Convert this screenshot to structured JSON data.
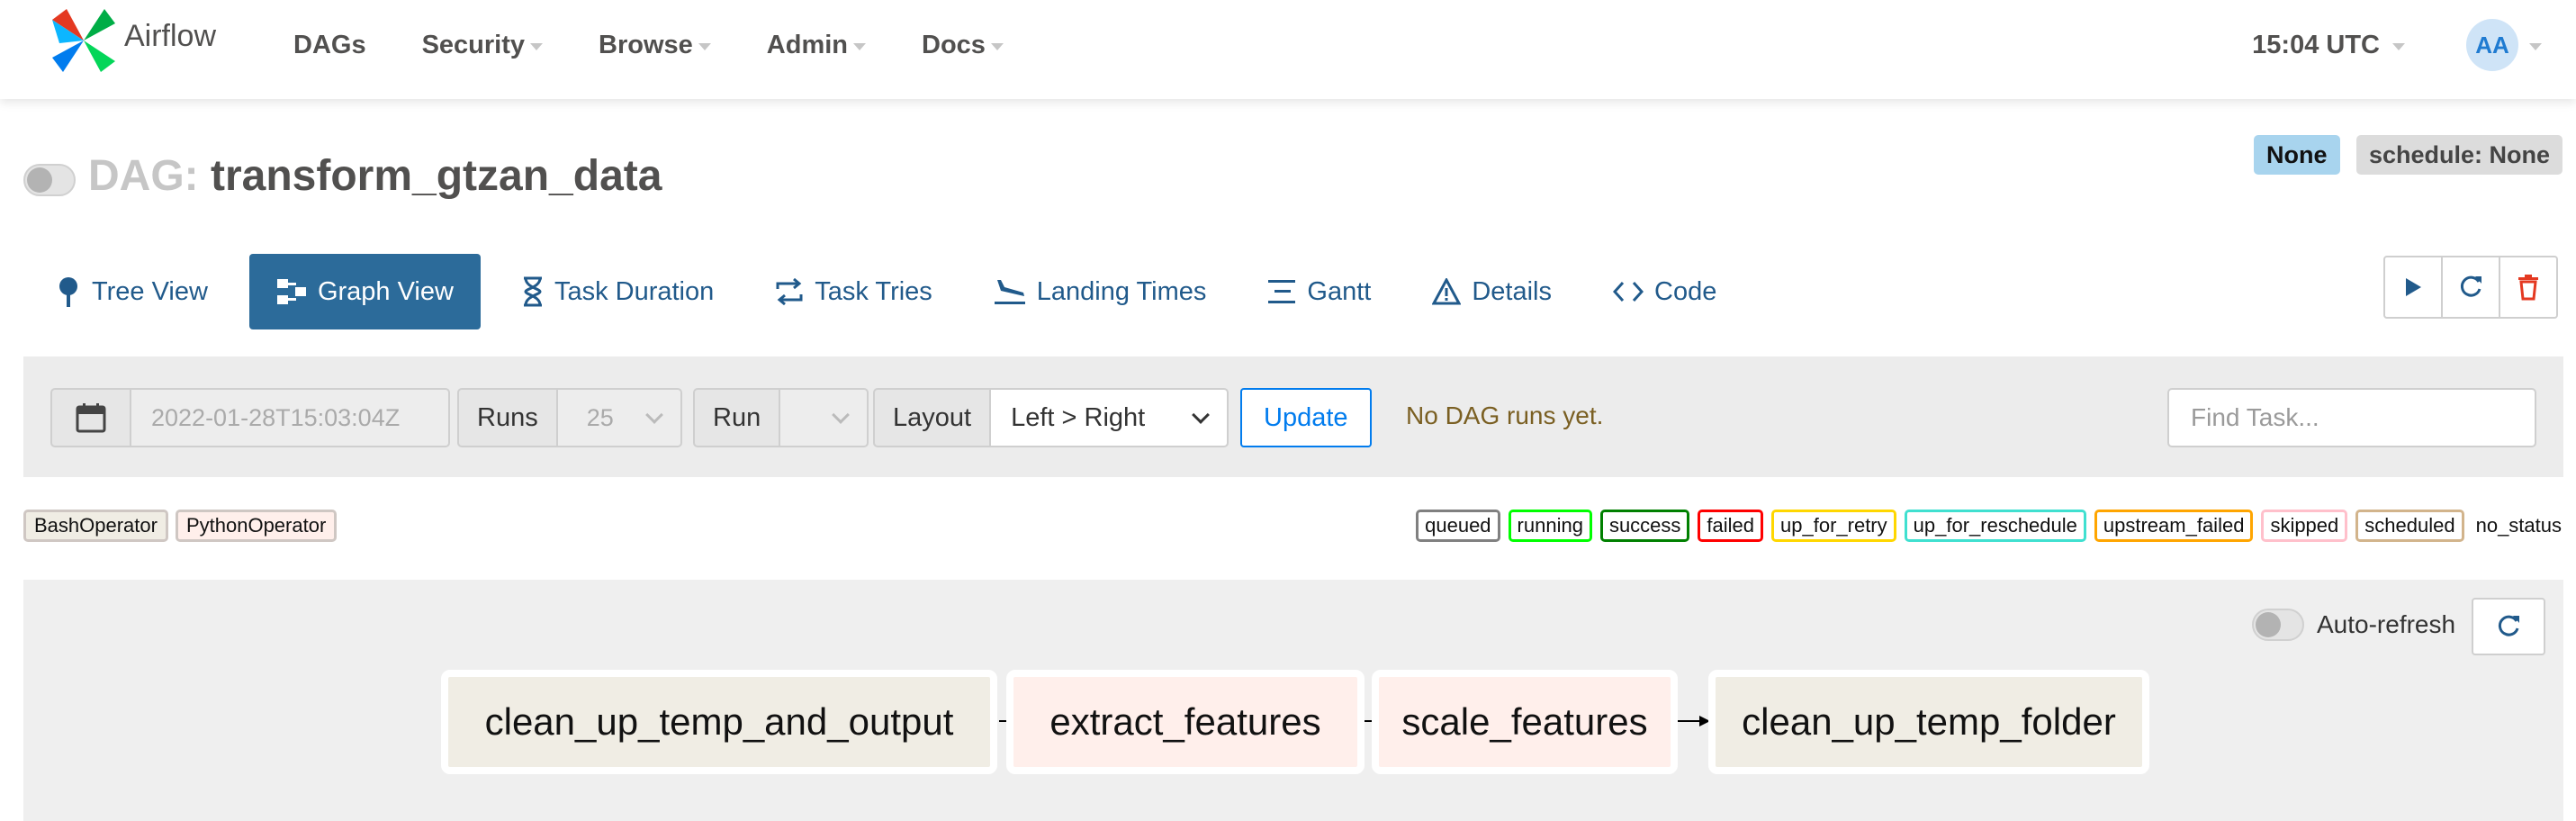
{
  "brand": {
    "name": "Airflow"
  },
  "nav": {
    "items": [
      "DAGs",
      "Security",
      "Browse",
      "Admin",
      "Docs"
    ],
    "clock": "15:04 UTC",
    "user_initials": "AA"
  },
  "dag": {
    "prefix": "DAG:",
    "id": "transform_gtzan_data",
    "label_none": "None",
    "schedule": "schedule: None"
  },
  "tabs": [
    {
      "label": "Tree View",
      "icon": "tree-icon",
      "active": false
    },
    {
      "label": "Graph View",
      "icon": "graph-icon",
      "active": true
    },
    {
      "label": "Task Duration",
      "icon": "hourglass-icon",
      "active": false
    },
    {
      "label": "Task Tries",
      "icon": "retry-icon",
      "active": false
    },
    {
      "label": "Landing Times",
      "icon": "plane-landing-icon",
      "active": false
    },
    {
      "label": "Gantt",
      "icon": "gantt-icon",
      "active": false
    },
    {
      "label": "Details",
      "icon": "warning-triangle-icon",
      "active": false
    },
    {
      "label": "Code",
      "icon": "code-icon",
      "active": false
    }
  ],
  "filters": {
    "base_date": "2022-01-28T15:03:04Z",
    "runs_label": "Runs",
    "runs_value": "25",
    "run_label": "Run",
    "run_value": "",
    "layout_label": "Layout",
    "layout_value": "Left > Right",
    "update_label": "Update",
    "status_message": "No DAG runs yet.",
    "find_placeholder": "Find Task..."
  },
  "operators": [
    {
      "label": "BashOperator",
      "color": "#f0ede4"
    },
    {
      "label": "PythonOperator",
      "color": "#ffefeb"
    }
  ],
  "states": [
    {
      "label": "queued",
      "color": "#808080"
    },
    {
      "label": "running",
      "color": "#00ff00"
    },
    {
      "label": "success",
      "color": "#008000"
    },
    {
      "label": "failed",
      "color": "#ff0000"
    },
    {
      "label": "up_for_retry",
      "color": "#ffd700"
    },
    {
      "label": "up_for_reschedule",
      "color": "#40e0d0"
    },
    {
      "label": "upstream_failed",
      "color": "#ffa500"
    },
    {
      "label": "skipped",
      "color": "#ffc0cb"
    },
    {
      "label": "scheduled",
      "color": "#d2b48c"
    },
    {
      "label": "no_status",
      "color": ""
    }
  ],
  "graph": {
    "auto_refresh_label": "Auto-refresh",
    "tasks": [
      {
        "id": "clean_up_temp_and_output",
        "color": "#f0ede4"
      },
      {
        "id": "extract_features",
        "color": "#ffefeb"
      },
      {
        "id": "scale_features",
        "color": "#ffefeb"
      },
      {
        "id": "clean_up_temp_folder",
        "color": "#f0ede4"
      }
    ]
  }
}
